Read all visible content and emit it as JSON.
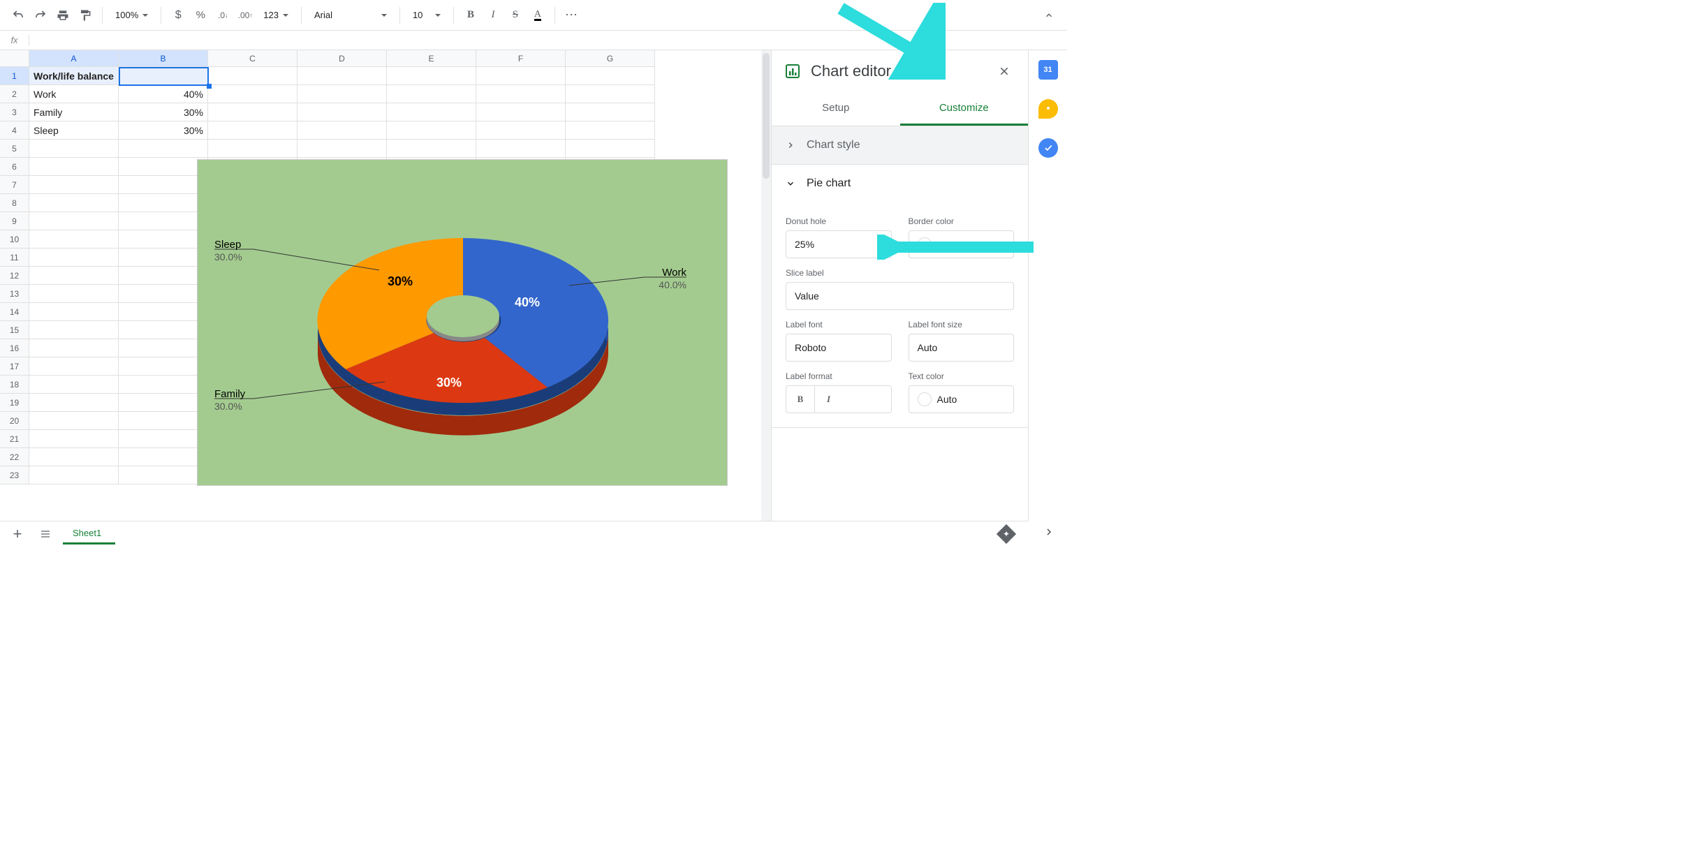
{
  "toolbar": {
    "zoom": "100%",
    "font": "Arial",
    "font_size": "10"
  },
  "columns": [
    "A",
    "B",
    "C",
    "D",
    "E",
    "F",
    "G"
  ],
  "row_count": 23,
  "cells": {
    "A1": "Work/life balance",
    "A2": "Work",
    "B2": "40%",
    "A3": "Family",
    "B3": "30%",
    "A4": "Sleep",
    "B4": "30%"
  },
  "selected_cell": "B1",
  "chart_data": {
    "type": "pie",
    "title": "",
    "categories": [
      "Work",
      "Family",
      "Sleep"
    ],
    "values": [
      40,
      30,
      30
    ],
    "labels_inner": [
      "40%",
      "30%",
      "30%"
    ],
    "labels_outer": [
      {
        "name": "Work",
        "pct": "40.0%"
      },
      {
        "name": "Family",
        "pct": "30.0%"
      },
      {
        "name": "Sleep",
        "pct": "30.0%"
      }
    ],
    "donut_hole": 0.25,
    "colors": {
      "Work": "#3366cc",
      "Family": "#dc3912",
      "Sleep": "#ff9900"
    },
    "background": "#a3cb8f",
    "style": "3d-donut"
  },
  "editor": {
    "title": "Chart editor",
    "tabs": {
      "setup": "Setup",
      "customize": "Customize"
    },
    "active_tab": "customize",
    "sections": {
      "chart_style": "Chart style",
      "pie_chart": "Pie chart"
    },
    "fields": {
      "donut_hole": {
        "label": "Donut hole",
        "value": "25%"
      },
      "border_color": {
        "label": "Border color"
      },
      "slice_label": {
        "label": "Slice label",
        "value": "Value"
      },
      "label_font": {
        "label": "Label font",
        "value": "Roboto"
      },
      "label_font_size": {
        "label": "Label font size",
        "value": "Auto"
      },
      "label_format": {
        "label": "Label format"
      },
      "text_color": {
        "label": "Text color",
        "value": "Auto"
      }
    }
  },
  "sheet_tab": "Sheet1",
  "rail": {
    "calendar_day": "31"
  }
}
